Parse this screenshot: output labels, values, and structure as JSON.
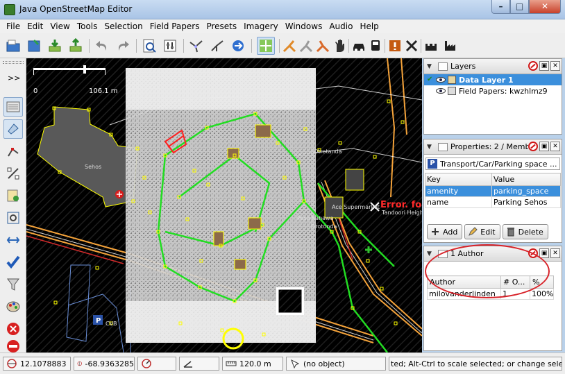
{
  "window": {
    "title": "Java OpenStreetMap Editor",
    "min_glyph": "–",
    "max_glyph": "□",
    "close_glyph": "✕"
  },
  "menu": [
    "File",
    "Edit",
    "View",
    "Tools",
    "Selection",
    "Field Papers",
    "Presets",
    "Imagery",
    "Windows",
    "Audio",
    "Help"
  ],
  "toolbar_icons": [
    "open-icon",
    "save-icon",
    "download-icon",
    "upload-icon",
    "undo-icon",
    "redo-icon",
    "zoom-preferences-icon",
    "preferences-icon",
    "split-icon",
    "combine-icon",
    "reverse-icon",
    "select-icon",
    "restriction-icon",
    "delete-way-icon",
    "relation-icon",
    "pan-hand-icon",
    "car-icon",
    "bus-icon",
    "warning-icon",
    "tools-icon",
    "castle-icon",
    "factory-icon"
  ],
  "left_tools_more": ">>",
  "map": {
    "scale_left": "0",
    "scale_right": "106.1 m",
    "area_label": "Sehos",
    "error_label": "Error. fo",
    "labels": [
      "Ace Supermarket",
      "Tandoori Heights",
      "Pesa Kahawa",
      "Orotonda",
      "CVB",
      "Otrotanda"
    ]
  },
  "layers": {
    "title": "Layers",
    "items": [
      {
        "name": "Data Layer 1",
        "selected": true,
        "active": true
      },
      {
        "name": "Field Papers: kwzhlmz9",
        "selected": false,
        "active": false
      }
    ]
  },
  "properties": {
    "title": "Properties: 2 / Membe",
    "preset": "Transport/Car/Parking space ...",
    "preset_badge": "P",
    "headers": [
      "Key",
      "Value"
    ],
    "rows": [
      {
        "key": "amenity",
        "value": "parking_space",
        "selected": true
      },
      {
        "key": "name",
        "value": "Parking Sehos",
        "selected": false
      }
    ],
    "buttons": {
      "add": "Add",
      "edit": "Edit",
      "delete": "Delete"
    }
  },
  "authors": {
    "title": "1 Author",
    "headers": [
      "Author",
      "# O...",
      "%"
    ],
    "rows": [
      {
        "author": "milovanderlinden",
        "count": "1",
        "percent": "100%"
      }
    ]
  },
  "status": {
    "lat": "12.1078883",
    "lon": "-68.9363285",
    "distance": "120.0 m",
    "object": "(no object)",
    "help": "ted; Alt-Ctrl to scale selected; or change selection"
  },
  "colors": {
    "selection_blue": "#3b8fdc",
    "annotation_red": "#d8232a",
    "map_bg": "#000000",
    "way_green": "#22dd22",
    "node_yellow": "#ffff00"
  }
}
